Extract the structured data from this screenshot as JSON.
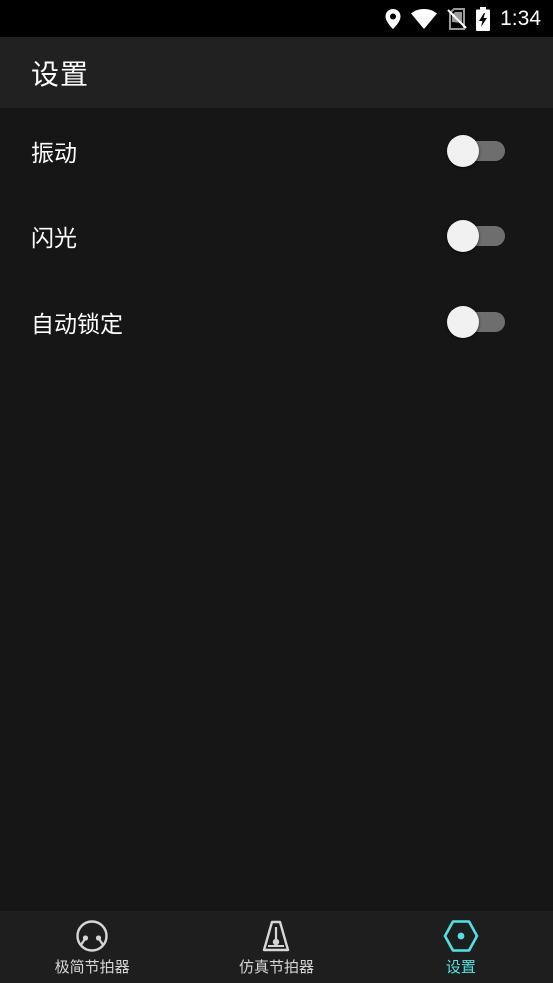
{
  "status_bar": {
    "time": "1:34",
    "icons": [
      "location-icon",
      "wifi-icon",
      "no-sim-icon",
      "battery-charging-icon"
    ]
  },
  "app_bar": {
    "title": "设置"
  },
  "settings": [
    {
      "label": "振动",
      "enabled": false
    },
    {
      "label": "闪光",
      "enabled": false
    },
    {
      "label": "自动锁定",
      "enabled": false
    }
  ],
  "bottom_nav": {
    "items": [
      {
        "label": "极简节拍器",
        "icon": "simple-metronome-icon",
        "active": false
      },
      {
        "label": "仿真节拍器",
        "icon": "metronome-icon",
        "active": false
      },
      {
        "label": "设置",
        "icon": "settings-hex-icon",
        "active": true
      }
    ]
  },
  "colors": {
    "accent": "#4fe3e3",
    "background": "#161616",
    "app_bar": "#212121",
    "nav_bar": "#1e1e1e",
    "switch_track_off": "#6e6e6e",
    "switch_thumb_off": "#f1f1f1"
  }
}
